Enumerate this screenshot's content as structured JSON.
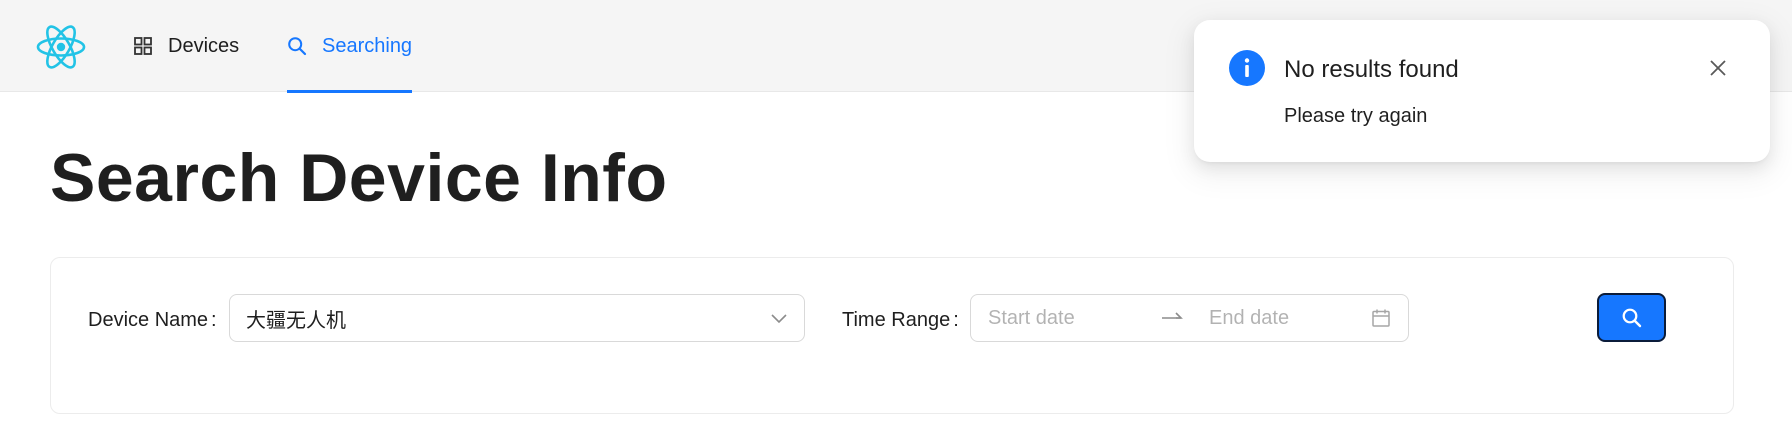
{
  "colors": {
    "primary": "#1677ff",
    "logo": "#22c3e6",
    "header_bg": "#f5f5f5",
    "title_text": "#1f1f1f"
  },
  "header": {
    "logo_icon": "react-atom-icon",
    "nav": [
      {
        "label": "Devices",
        "icon": "appstore-grid-icon",
        "active": false
      },
      {
        "label": "Searching",
        "icon": "search-icon",
        "active": true
      }
    ]
  },
  "page": {
    "title": "Search Device Info"
  },
  "form": {
    "device_label": "Device Name",
    "device_value": "大疆无人机",
    "time_label": "Time Range",
    "start_placeholder": "Start date",
    "end_placeholder": "End date",
    "submit_icon": "search-icon"
  },
  "notification": {
    "icon": "info-circle-icon",
    "title": "No results found",
    "description": "Please try again",
    "close_icon": "close-icon"
  }
}
